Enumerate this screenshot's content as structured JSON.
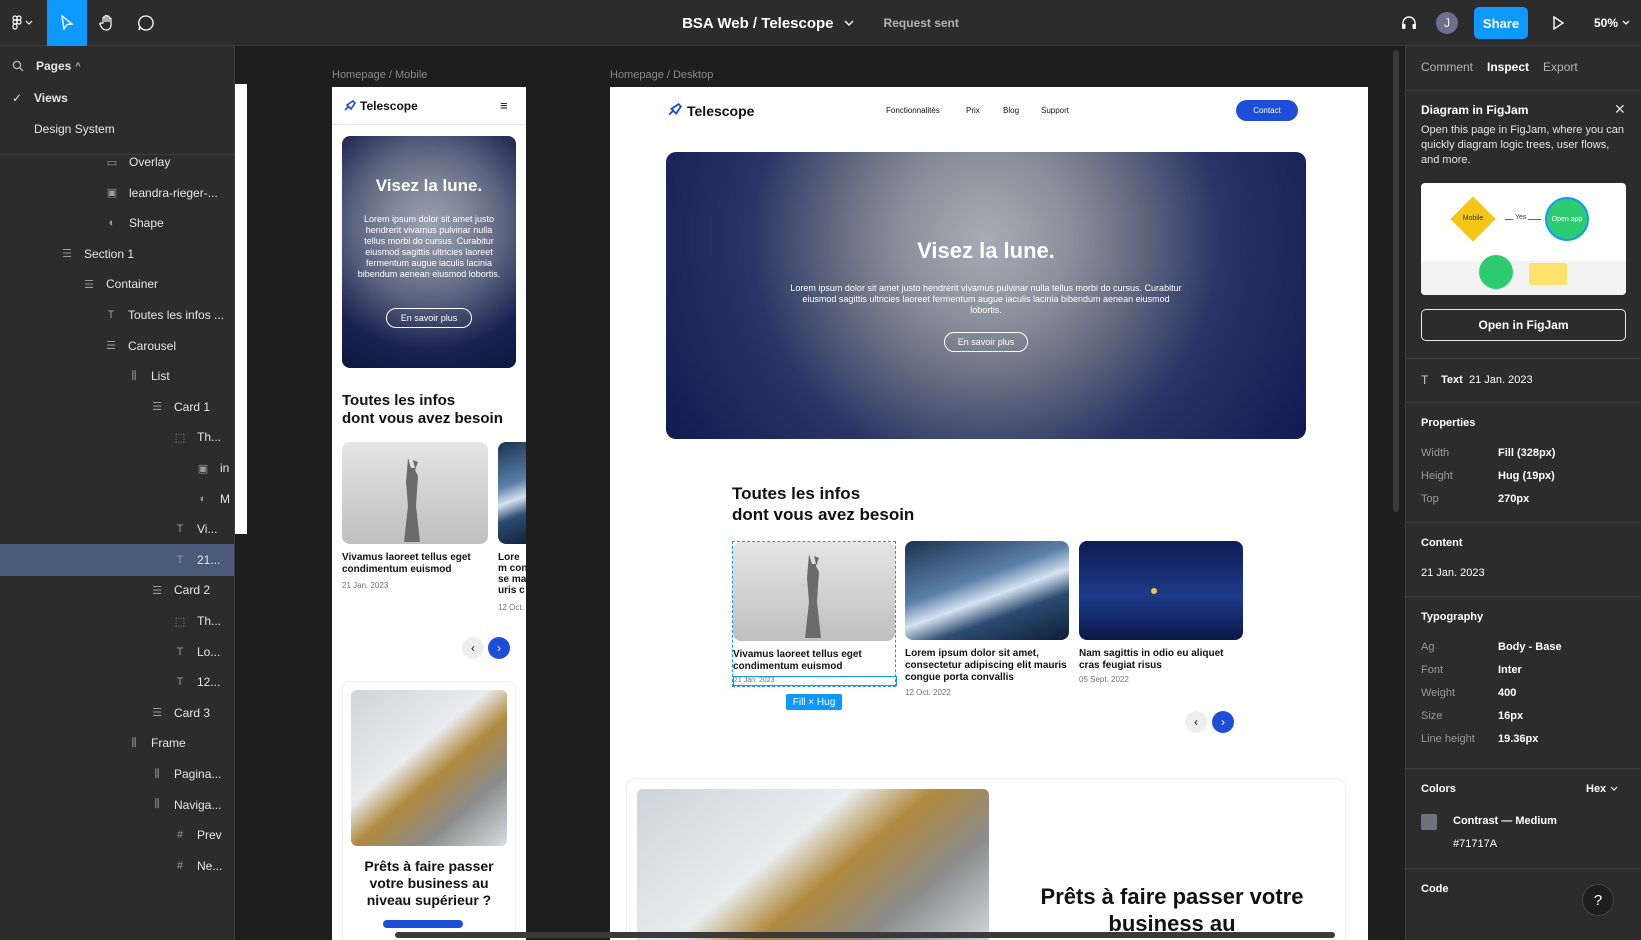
{
  "topbar": {
    "file_title": "BSA Web / Telescope",
    "status": "Request sent",
    "share_label": "Share",
    "avatar_initial": "J",
    "zoom": "50%"
  },
  "left_panel": {
    "pages_label": "Pages",
    "pages": [
      {
        "label": "Views",
        "checked": true
      },
      {
        "label": "Design System",
        "checked": false
      }
    ],
    "layers": [
      {
        "label": "Overlay",
        "icon": "rect-icon"
      },
      {
        "label": "leandra-rieger-...",
        "icon": "image-icon"
      },
      {
        "label": "Shape",
        "icon": "mask-icon"
      },
      {
        "label": "Section 1",
        "icon": "frame-lines-icon"
      },
      {
        "label": "Container",
        "icon": "frame-lines-icon"
      },
      {
        "label": "Toutes les infos ...",
        "icon": "text-icon"
      },
      {
        "label": "Carousel",
        "icon": "frame-lines-icon"
      },
      {
        "label": "List",
        "icon": "hstack-icon"
      },
      {
        "label": "Card 1",
        "icon": "frame-lines-icon"
      },
      {
        "label": "Th...",
        "icon": "dashed-frame-icon"
      },
      {
        "label": "in",
        "icon": "image-icon"
      },
      {
        "label": "M",
        "icon": "mask-icon"
      },
      {
        "label": "Vi...",
        "icon": "text-icon"
      },
      {
        "label": "21...",
        "icon": "text-icon"
      },
      {
        "label": "Card 2",
        "icon": "frame-lines-icon"
      },
      {
        "label": "Th...",
        "icon": "dashed-frame-icon"
      },
      {
        "label": "Lo...",
        "icon": "text-icon"
      },
      {
        "label": "12...",
        "icon": "text-icon"
      },
      {
        "label": "Card 3",
        "icon": "frame-lines-icon"
      },
      {
        "label": "Frame",
        "icon": "hstack-icon"
      },
      {
        "label": "Pagina...",
        "icon": "hstack-icon"
      },
      {
        "label": "Naviga...",
        "icon": "hstack-icon"
      },
      {
        "label": "Prev",
        "icon": "hash-icon"
      },
      {
        "label": "Ne...",
        "icon": "hash-icon"
      }
    ]
  },
  "canvas": {
    "mobile_label": "Homepage / Mobile",
    "desktop_label": "Homepage / Desktop",
    "brand": "Telescope",
    "hero_title": "Visez la lune.",
    "hero_text_mobile": "Lorem ipsum dolor sit amet justo hendrerit vivamus pulvinar nulla tellus morbi do cursus. Curabitur eiusmod sagittis ultricies laoreet fermentum augue iaculis lacinia bibendum aenean eiusmod lobortis.",
    "hero_text_desktop": "Lorem ipsum dolor sit amet justo hendrerit vivamus pulvinar nulla tellus morbi do cursus. Curabitur eiusmod sagittis ultricies laoreet fermentum augue iaculis lacinia bibendum aenean eiusmod lobortis.",
    "hero_button": "En savoir plus",
    "section_title_line1": "Toutes les infos",
    "section_title_line2": "dont vous avez besoin",
    "nav": [
      "Fonctionnalités",
      "Prix",
      "Blog",
      "Support"
    ],
    "contact_button": "Contact",
    "cards": [
      {
        "title": "Vivamus laoreet tellus eget condimentum euismod",
        "date": "21 Jan. 2023"
      },
      {
        "title": "Lorem ipsum dolor sit amet, consectetur adipiscing elit mauris congue porta convallis",
        "date": "12 Oct. 2022"
      },
      {
        "title": "Nam sagittis in odio eu aliquet cras feugiat risus",
        "date": "05 Sept. 2022"
      }
    ],
    "mobile_card2_title_partial": "Lorem conse mauris conva",
    "mobile_card2_date_partial": "12 Oct.",
    "selection_badge": "Fill × Hug",
    "cta_title": "Prêts à faire passer votre business au niveau supérieur ?",
    "cta_title_desktop": "Prêts à faire passer votre business au"
  },
  "right_panel": {
    "tabs": [
      "Comment",
      "Inspect",
      "Export"
    ],
    "active_tab": "Inspect",
    "figjam_title": "Diagram in FigJam",
    "figjam_text": "Open this page in FigJam, where you can quickly diagram logic trees, user flows, and more.",
    "figjam_diagram": {
      "node1": "Mobile",
      "edge": "Yes",
      "node2": "Open app"
    },
    "figjam_button": "Open in FigJam",
    "layer_type": "Text",
    "layer_name": "21 Jan. 2023",
    "properties_title": "Properties",
    "properties": [
      {
        "label": "Width",
        "value": "Fill (328px)"
      },
      {
        "label": "Height",
        "value": "Hug (19px)"
      },
      {
        "label": "Top",
        "value": "270px"
      }
    ],
    "content_title": "Content",
    "content_value": "21 Jan. 2023",
    "typography_title": "Typography",
    "typography": [
      {
        "label": "Ag",
        "value": "Body - Base"
      },
      {
        "label": "Font",
        "value": "Inter"
      },
      {
        "label": "Weight",
        "value": "400"
      },
      {
        "label": "Size",
        "value": "16px"
      },
      {
        "label": "Line height",
        "value": "19.36px"
      }
    ],
    "colors_title": "Colors",
    "color_format": "Hex",
    "color_name": "Contrast — Medium",
    "color_hex": "#71717A",
    "code_title": "Code",
    "help": "?"
  },
  "colors": {
    "accent": "#0d99ff",
    "brand_blue": "#1d4ed8",
    "swatch": "#71717A",
    "selected_row": "#4c5a7a"
  }
}
